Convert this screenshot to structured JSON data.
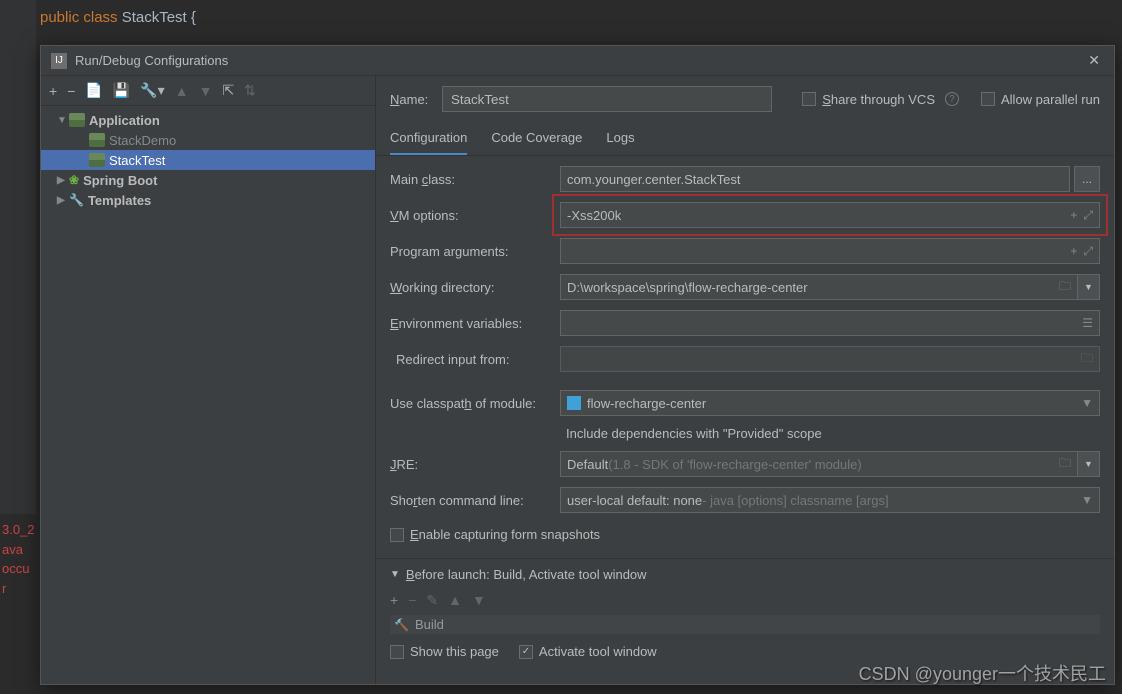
{
  "code": {
    "line1_kw": "public class ",
    "line1_cls": "StackTest {"
  },
  "dialog": {
    "title": "Run/Debug Configurations"
  },
  "tree": {
    "app": "Application",
    "items": [
      "StackDemo",
      "StackTest"
    ],
    "spring": "Spring Boot",
    "templates": "Templates"
  },
  "nameRow": {
    "label": "Name:",
    "value": "StackTest",
    "share": "Share through VCS",
    "parallel": "Allow parallel run"
  },
  "tabs": [
    "Configuration",
    "Code Coverage",
    "Logs"
  ],
  "form": {
    "mainClass": {
      "label": "Main class:",
      "value": "com.younger.center.StackTest"
    },
    "vmOptions": {
      "label": "VM options:",
      "value": "-Xss200k"
    },
    "progArgs": {
      "label": "Program arguments:",
      "value": ""
    },
    "workDir": {
      "label": "Working directory:",
      "value": "D:\\workspace\\spring\\flow-recharge-center"
    },
    "envVars": {
      "label": "Environment variables:",
      "value": ""
    },
    "redirect": {
      "label": "Redirect input from:",
      "value": ""
    },
    "classpath": {
      "label": "Use classpath of module:",
      "value": "flow-recharge-center"
    },
    "includeProvided": "Include dependencies with \"Provided\" scope",
    "jre": {
      "label": "JRE:",
      "value": "Default ",
      "hint": "(1.8 - SDK of 'flow-recharge-center' module)"
    },
    "shorten": {
      "label": "Shorten command line:",
      "value": "user-local default: none ",
      "hint": "- java [options] classname [args]"
    },
    "enableCapture": "Enable capturing form snapshots"
  },
  "before": {
    "header": "Before launch: Build, Activate tool window",
    "build": "Build",
    "showPage": "Show this page",
    "activate": "Activate tool window"
  },
  "console": [
    "3.0_2",
    "ava",
    "occu",
    "r"
  ],
  "watermark": "CSDN @younger一个技术民工"
}
